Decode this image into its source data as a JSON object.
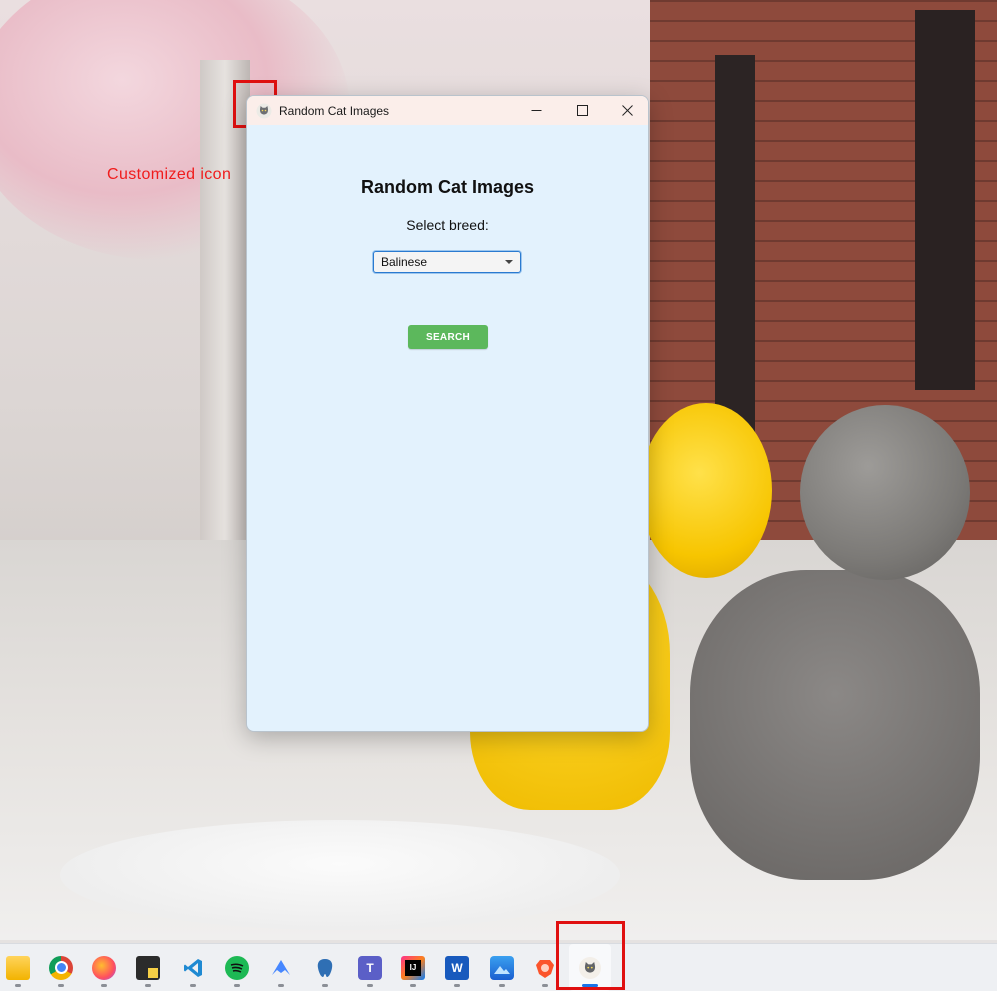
{
  "window": {
    "title": "Random Cat Images",
    "icon": "cat-icon"
  },
  "app": {
    "heading": "Random Cat Images",
    "select_label": "Select breed:",
    "breed_selected": "Balinese",
    "search_label": "SEARCH",
    "background_color": "#e3f2fd",
    "button_color": "#5cb85c"
  },
  "annotation": {
    "text": "Customized icon",
    "color": "#f01c1c"
  },
  "taskbar": {
    "items": [
      {
        "name": "file-explorer-icon"
      },
      {
        "name": "chrome-icon"
      },
      {
        "name": "firefox-icon"
      },
      {
        "name": "sticky-notes-icon"
      },
      {
        "name": "vscode-icon"
      },
      {
        "name": "spotify-icon"
      },
      {
        "name": "nordvpn-icon"
      },
      {
        "name": "pgadmin-icon"
      },
      {
        "name": "teams-icon"
      },
      {
        "name": "intellij-icon"
      },
      {
        "name": "word-icon"
      },
      {
        "name": "photos-icon"
      },
      {
        "name": "brave-icon"
      },
      {
        "name": "cat-app-icon"
      }
    ]
  }
}
